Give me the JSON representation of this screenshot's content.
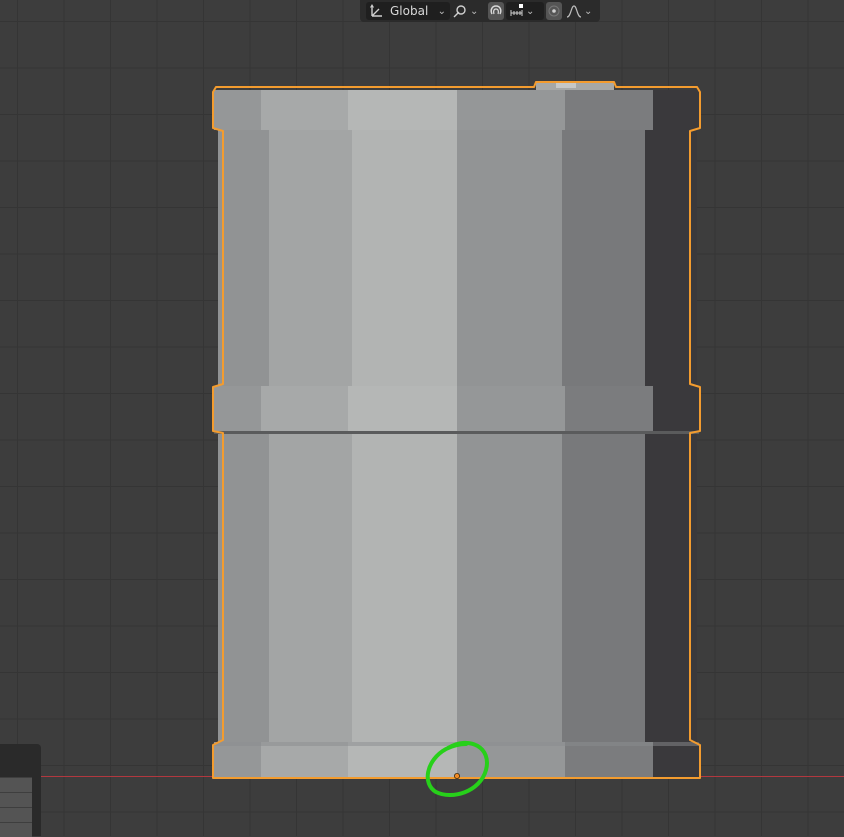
{
  "header": {
    "orientation_label": "Global",
    "icons": {
      "transform_orientation": "transform-axes-icon",
      "pivot": "pivot-link-icon",
      "snap": "magnet-snap-icon",
      "snap_target": "snap-increment-icon",
      "proportional_editing": "proportional-editing-icon",
      "falloff": "falloff-curve-icon"
    }
  },
  "colors": {
    "grid_background": "#3d3d3d",
    "grid_line": "#353535",
    "selection_outline": "#f39c2f",
    "x_axis": "#b2383f",
    "annotation_circle": "#27d01a",
    "origin_dot": "#f08a24"
  },
  "object": {
    "name_hint": "barrel",
    "selected": true
  }
}
